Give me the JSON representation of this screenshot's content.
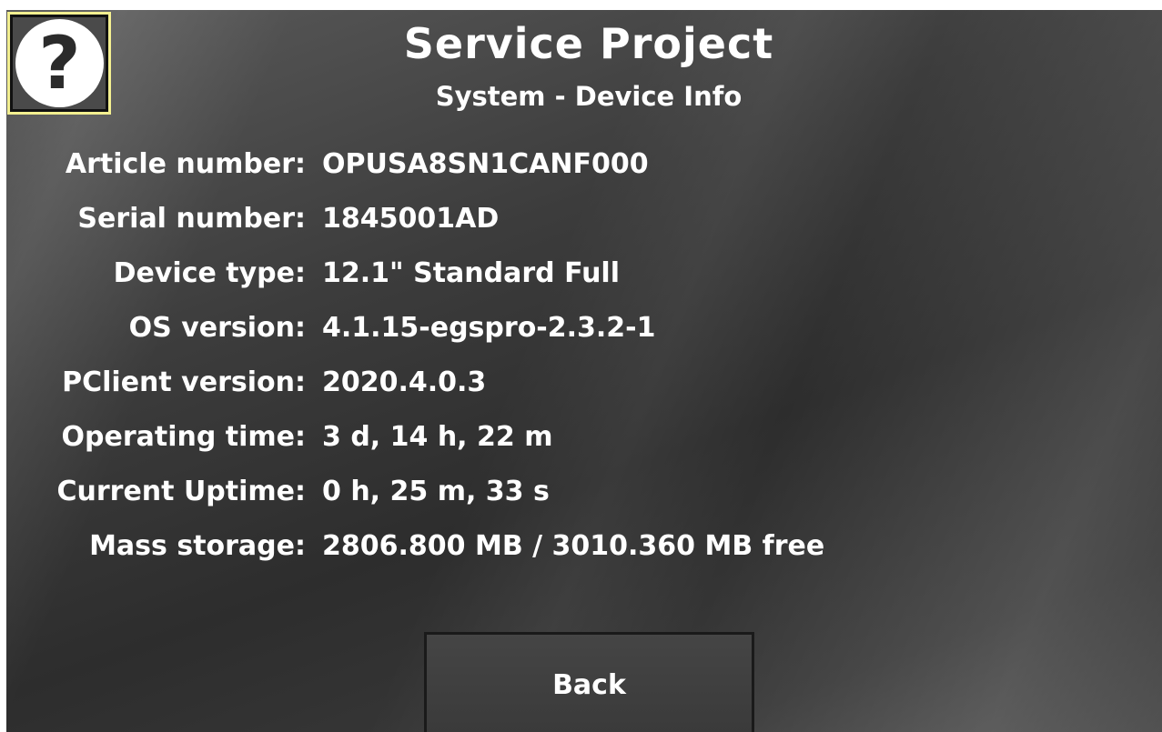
{
  "header": {
    "help_icon_glyph": "?",
    "title": "Service Project",
    "subtitle": "System - Device Info"
  },
  "info": [
    {
      "label": "Article number:",
      "value": "OPUSA8SN1CANF000"
    },
    {
      "label": "Serial number:",
      "value": "1845001AD"
    },
    {
      "label": "Device type:",
      "value": "12.1\" Standard Full"
    },
    {
      "label": "OS version:",
      "value": "4.1.15-egspro-2.3.2-1"
    },
    {
      "label": "PClient version:",
      "value": "2020.4.0.3"
    },
    {
      "label": "Operating time:",
      "value": "3 d, 14 h, 22 m"
    },
    {
      "label": "Current Uptime:",
      "value": "0 h, 25 m, 33 s"
    },
    {
      "label": "Mass storage:",
      "value": "2806.800 MB / 3010.360 MB free"
    }
  ],
  "footer": {
    "back_label": "Back"
  },
  "colors": {
    "text": "#ffffff",
    "help_border": "#f3ef90",
    "background": "#3c3c3c"
  }
}
